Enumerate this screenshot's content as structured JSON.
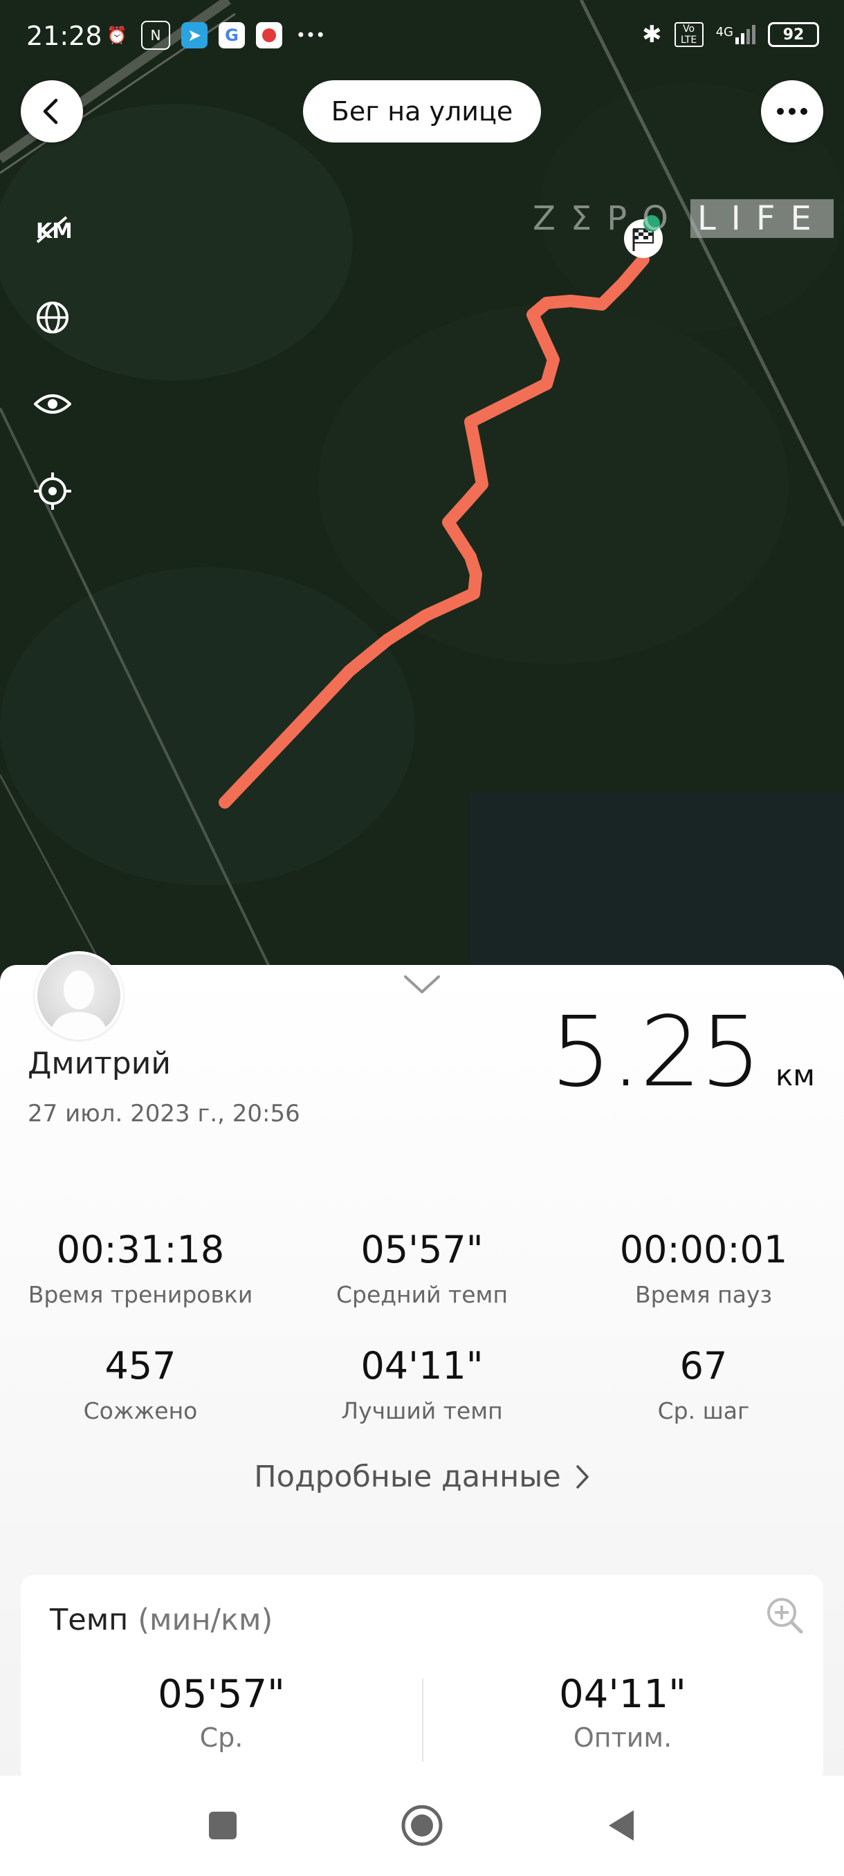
{
  "status_bar": {
    "time": "21:28",
    "left_icons": [
      "alarm-icon",
      "nfc-icon",
      "telegram-icon",
      "google-icon",
      "app-icon",
      "more-dots"
    ],
    "overflow": "•••",
    "network": "4G",
    "volte": "Vo LTE",
    "battery": "92"
  },
  "header": {
    "title": "Бег на улице",
    "back_icon": "back-arrow-icon",
    "menu_icon": "more-icon"
  },
  "map_tools": [
    "km-markers-icon",
    "globe-icon",
    "eye-icon",
    "locate-icon"
  ],
  "watermark": {
    "left": "ZΣPO",
    "right": "LIFE"
  },
  "route": {
    "color": "#f26f55",
    "end_icon": "finish-flag-icon"
  },
  "user": {
    "name": "Дмитрий",
    "date": "27 июл. 2023 г., 20:56"
  },
  "distance": {
    "value": "5.25",
    "unit": "км"
  },
  "stats": [
    {
      "value": "00:31:18",
      "label": "Время тренировки"
    },
    {
      "value": "05'57\"",
      "label": "Средний темп"
    },
    {
      "value": "00:00:01",
      "label": "Время пауз"
    },
    {
      "value": "457",
      "label": "Сожжено"
    },
    {
      "value": "04'11\"",
      "label": "Лучший темп"
    },
    {
      "value": "67",
      "label": "Ср. шаг"
    }
  ],
  "details_link": "Подробные данные",
  "pace_card": {
    "title": "Темп",
    "unit": "(мин/км)",
    "avg_value": "05'57\"",
    "avg_label": "Ср.",
    "best_value": "04'11\"",
    "best_label": "Оптим."
  },
  "colors": {
    "accent": "#f26f55",
    "map_bg": "#1a2a1c"
  }
}
